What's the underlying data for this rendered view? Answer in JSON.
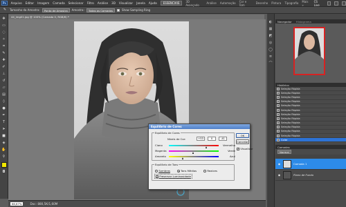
{
  "menubar": {
    "logo": "Ps",
    "items": [
      "Arquivo",
      "Editar",
      "Imagem",
      "Camada",
      "Selecionar",
      "Filtro",
      "Análise",
      "3D",
      "Visualizar",
      "Janela",
      "Ajuda"
    ],
    "workspace_active": "ESSENCIAIS",
    "workspaces": [
      "3D Avançado",
      "Análise",
      "Automação",
      "Cor e Tom",
      "Desenho",
      "Pintura",
      "Tipografia"
    ],
    "more": "Mais »",
    "cs_live": "CS Live"
  },
  "options": {
    "sample_size_label": "Tamanho da Amostra:",
    "sample_size_value": "Ponto de Amostra",
    "sample_label": "Amostra:",
    "sample_value": "Todas as Camadas",
    "show_ring": "Show Sampling Ring"
  },
  "document": {
    "tab_title": "44_img01.jpg @ 100% (Camada 0, RGB/8) *",
    "zoom": "66,67%",
    "doc_info": "Doc: 880,5K/1,60M"
  },
  "panels": {
    "navigator_tab": "Navegador",
    "histogram_tab": "Histograma",
    "history_tab": "Histórico",
    "history_items": [
      "Seleção Rápida",
      "Seleção Rápida",
      "Seleção Rápida",
      "Seleção Rápida",
      "Seleção Rápida",
      "Seleção Rápida",
      "Seleção Rápida",
      "Seleção Rápida",
      "Seleção Rápida",
      "Seleção Rápida",
      "Seleção Rápida",
      "Seleção Rápida",
      "Colar"
    ],
    "layers_tab": "Camadas",
    "blend_mode": "Normal",
    "layers": [
      {
        "name": "Camada 1",
        "active": true
      },
      {
        "name": "Plano de Fundo",
        "active": false
      }
    ]
  },
  "dialog": {
    "title": "Equilíbrio de Cores",
    "group1_label": "Equilíbrio de Cores",
    "level_label": "Níveis de Cor:",
    "level_values": [
      "+53",
      "0",
      "-41"
    ],
    "sliders": [
      {
        "left": "Ciano",
        "right": "Vermelho",
        "value": 53
      },
      {
        "left": "Magenta",
        "right": "Verde",
        "value": 0
      },
      {
        "left": "Amarelo",
        "right": "Azul",
        "value": -41
      }
    ],
    "group2_label": "Equilíbrio de Tons",
    "tones": [
      "Sombras",
      "Tons Médios",
      "Realces"
    ],
    "tone_selected": "Tons Médios",
    "preserve": "Preservar Luminosidade",
    "ok": "OK",
    "cancel": "Cancelar",
    "preview": "Visualizar"
  },
  "colors": {
    "foreground": "#f2e800",
    "selection_blue": "#2d8be8",
    "navigator_frame": "#d72222"
  }
}
